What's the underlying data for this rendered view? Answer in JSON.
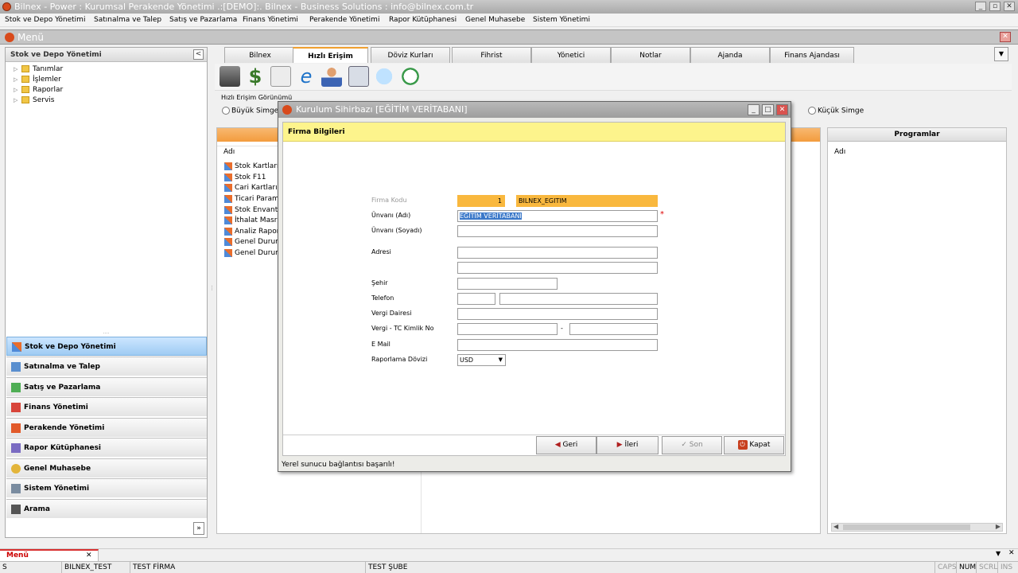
{
  "window": {
    "title": "Bilnex - Power : Kurumsal Perakende Yönetimi      .:[DEMO]:.      Bilnex - Business Solutions : info@bilnex.com.tr"
  },
  "menubar": [
    "Stok ve Depo Yönetimi",
    "Satınalma ve Talep",
    "Satış ve Pazarlama",
    "Finans Yönetimi",
    "Perakende Yönetimi",
    "Rapor Kütüphanesi",
    "Genel Muhasebe",
    "Sistem Yönetimi"
  ],
  "mdi": {
    "title": "Menü"
  },
  "left_panel": {
    "header": "Stok ve Depo Yönetimi",
    "collapse_glyph": "<",
    "expand_glyph": "»",
    "tree": [
      "Tanımlar",
      "İşlemler",
      "Raporlar",
      "Servis"
    ],
    "nav": [
      "Stok ve Depo Yönetimi",
      "Satınalma ve Talep",
      "Satış ve Pazarlama",
      "Finans Yönetimi",
      "Perakende Yönetimi",
      "Rapor Kütüphanesi",
      "Genel Muhasebe",
      "Sistem Yönetimi",
      "Arama"
    ]
  },
  "tabs": [
    "Bilnex",
    "Hızlı Erişim",
    "Döviz Kurları",
    "Fihrist",
    "Yönetici",
    "Notlar",
    "Ajanda",
    "Finans Ajandası"
  ],
  "tabs_dropdown_glyph": "▼",
  "toolbar_icons": [
    "disk-icon",
    "dollar-icon",
    "txt-file-icon",
    "internet-explorer-icon",
    "user-icon",
    "calculator-icon",
    "chat-icon",
    "clock-icon"
  ],
  "quick_access": {
    "group_label": "Hızlı Erişim Görünümü",
    "large_icons": "Büyük Simge",
    "small_icons": "Küçük Simge"
  },
  "list_grid": {
    "column": "Adı",
    "items": [
      "Stok Kartları",
      "Stok F11",
      "Cari Kartları",
      "Ticari Paramet",
      "Stok Envanter",
      "İthalat Masraf",
      "Analiz Raporu",
      "Genel Durum R",
      "Genel Durum R"
    ]
  },
  "programs": {
    "header": "Programlar",
    "column": "Adı"
  },
  "dialog": {
    "title": "Kurulum Sihirbazı [EĞİTİM VERİTABANI]",
    "section": "Firma Bilgileri",
    "labels": {
      "firma_kodu": "Firma Kodu",
      "unvani_adi": "Ünvanı (Adı)",
      "unvani_soyadi": "Ünvanı (Soyadı)",
      "adresi": "Adresi",
      "sehir": "Şehir",
      "telefon": "Telefon",
      "vergi_dairesi": "Vergi Dairesi",
      "vergi_tc": "Vergi - TC Kimlik No",
      "email": "E Mail",
      "raporlama_dovizi": "Raporlama Dövizi"
    },
    "values": {
      "firma_kodu_no": "1",
      "firma_kodu_name": "BILNEX_EGITIM",
      "unvani_adi": "EĞİTİM VERİTABANI",
      "required_mark": "*",
      "dash": "-",
      "doviz": "USD"
    },
    "buttons": {
      "back": "Geri",
      "next": "İleri",
      "finish": "Son",
      "close": "Kapat"
    },
    "status": "Yerel sunucu bağlantısı başarılı!"
  },
  "bottom_tab": {
    "label": "Menü",
    "close": "✕"
  },
  "statusbar": {
    "cells": [
      "S",
      "BILNEX_TEST",
      "TEST FİRMA",
      "TEST ŞUBE"
    ],
    "keys": [
      "CAPS",
      "NUM",
      "SCRL",
      "INS"
    ]
  }
}
